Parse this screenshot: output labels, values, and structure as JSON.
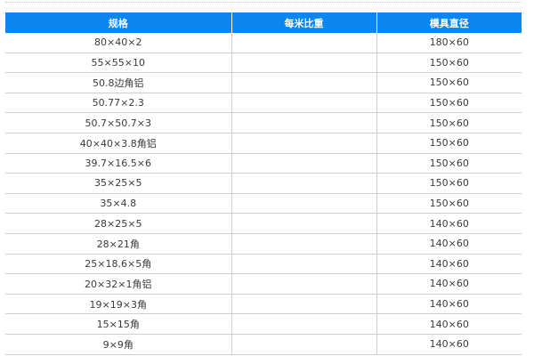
{
  "table": {
    "headers": [
      "规格",
      "每米比重",
      "模具直径"
    ],
    "rows": [
      [
        "80×40×2",
        "",
        "180×60"
      ],
      [
        "55×55×10",
        "",
        "150×60"
      ],
      [
        "50.8边角铝",
        "",
        "150×60"
      ],
      [
        "50.77×2.3",
        "",
        "150×60"
      ],
      [
        "50.7×50.7×3",
        "",
        "150×60"
      ],
      [
        "40×40×3.8角铝",
        "",
        "150×60"
      ],
      [
        "39.7×16.5×6",
        "",
        "150×60"
      ],
      [
        "35×25×5",
        "",
        "150×60"
      ],
      [
        "35×4.8",
        "",
        "150×60"
      ],
      [
        "28×25×5",
        "",
        "140×60"
      ],
      [
        "28×21角",
        "",
        "140×60"
      ],
      [
        "25×18.6×5角",
        "",
        "140×60"
      ],
      [
        "20×32×1角铝",
        "",
        "140×60"
      ],
      [
        "19×19×3角",
        "",
        "140×60"
      ],
      [
        "15×15角",
        "",
        "140×60"
      ],
      [
        "9×9角",
        "",
        "140×60"
      ]
    ]
  },
  "colors": {
    "header_bg": "#0b86f0",
    "header_text": "#ffffff",
    "border": "#cfcfcf",
    "cell_text": "#3a3a3a"
  }
}
